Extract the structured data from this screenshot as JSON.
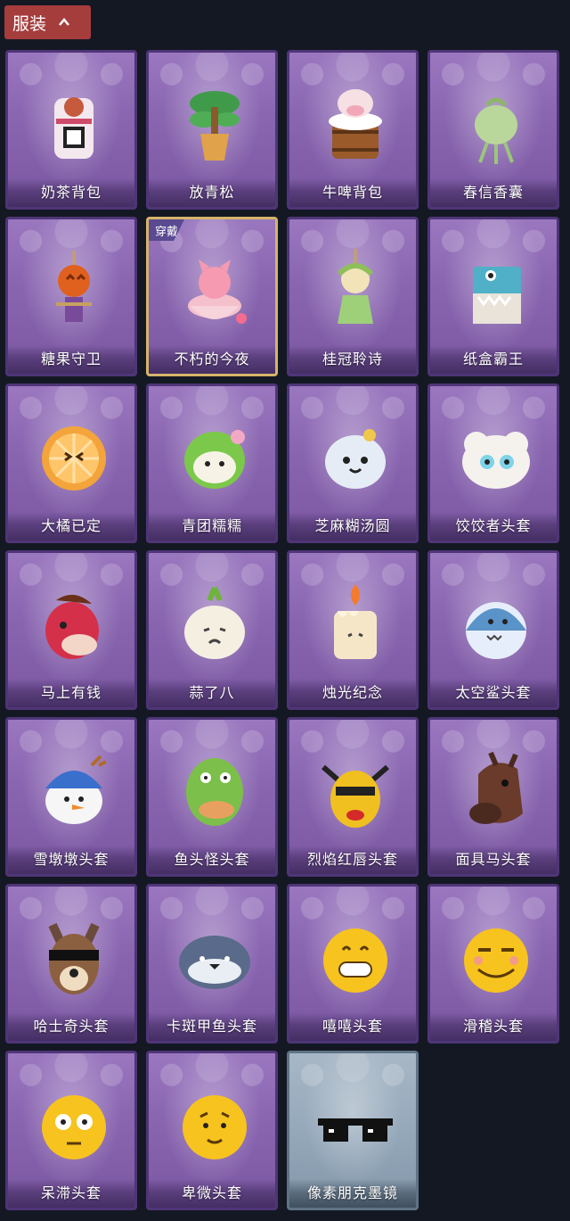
{
  "header": {
    "title": "服装",
    "expanded": true
  },
  "colors": {
    "background": "#141823",
    "header_bg": "#a63d3d",
    "card_purple": "#8a66b1",
    "card_grey": "#95a8ba",
    "selected_border": "#d6b46a"
  },
  "items": [
    {
      "label": "奶茶背包",
      "icon": "milk-tea-backpack-icon",
      "rarity": "purple"
    },
    {
      "label": "放青松",
      "icon": "pine-tree-icon",
      "rarity": "purple"
    },
    {
      "label": "牛啤背包",
      "icon": "cow-beer-backpack-icon",
      "rarity": "purple"
    },
    {
      "label": "春信香囊",
      "icon": "sachet-icon",
      "rarity": "purple"
    },
    {
      "label": "糖果守卫",
      "icon": "pumpkin-scarecrow-icon",
      "rarity": "purple"
    },
    {
      "label": "不朽的今夜",
      "icon": "pink-fox-bowl-icon",
      "rarity": "purple",
      "equipped": true,
      "tag": "穿戴"
    },
    {
      "label": "桂冠聆诗",
      "icon": "laurel-doll-icon",
      "rarity": "purple"
    },
    {
      "label": "纸盒霸王",
      "icon": "cardboard-dino-icon",
      "rarity": "purple"
    },
    {
      "label": "大橘已定",
      "icon": "orange-slice-head-icon",
      "rarity": "purple"
    },
    {
      "label": "青团糯糯",
      "icon": "green-dumpling-head-icon",
      "rarity": "purple"
    },
    {
      "label": "芝麻糊汤圆",
      "icon": "rice-ball-head-icon",
      "rarity": "purple"
    },
    {
      "label": "饺饺者头套",
      "icon": "dumpling-head-icon",
      "rarity": "purple"
    },
    {
      "label": "马上有钱",
      "icon": "red-horse-head-icon",
      "rarity": "purple"
    },
    {
      "label": "蒜了八",
      "icon": "garlic-head-icon",
      "rarity": "purple"
    },
    {
      "label": "烛光纪念",
      "icon": "candle-head-icon",
      "rarity": "purple"
    },
    {
      "label": "太空鲨头套",
      "icon": "shark-head-icon",
      "rarity": "purple"
    },
    {
      "label": "雪墩墩头套",
      "icon": "snowman-head-icon",
      "rarity": "purple"
    },
    {
      "label": "鱼头怪头套",
      "icon": "fish-head-icon",
      "rarity": "purple"
    },
    {
      "label": "烈焰红唇头套",
      "icon": "yellow-mask-head-icon",
      "rarity": "purple"
    },
    {
      "label": "面具马头套",
      "icon": "horse-mask-icon",
      "rarity": "purple"
    },
    {
      "label": "哈士奇头套",
      "icon": "husky-head-icon",
      "rarity": "purple"
    },
    {
      "label": "卡斑甲鱼头套",
      "icon": "turtle-head-icon",
      "rarity": "purple"
    },
    {
      "label": "嘻嘻头套",
      "icon": "grin-emoji-head-icon",
      "rarity": "purple"
    },
    {
      "label": "滑稽头套",
      "icon": "smirk-emoji-head-icon",
      "rarity": "purple"
    },
    {
      "label": "呆滞头套",
      "icon": "stunned-emoji-head-icon",
      "rarity": "purple"
    },
    {
      "label": "卑微头套",
      "icon": "humble-emoji-head-icon",
      "rarity": "purple"
    },
    {
      "label": "像素朋克墨镜",
      "icon": "pixel-sunglasses-icon",
      "rarity": "grey"
    }
  ]
}
